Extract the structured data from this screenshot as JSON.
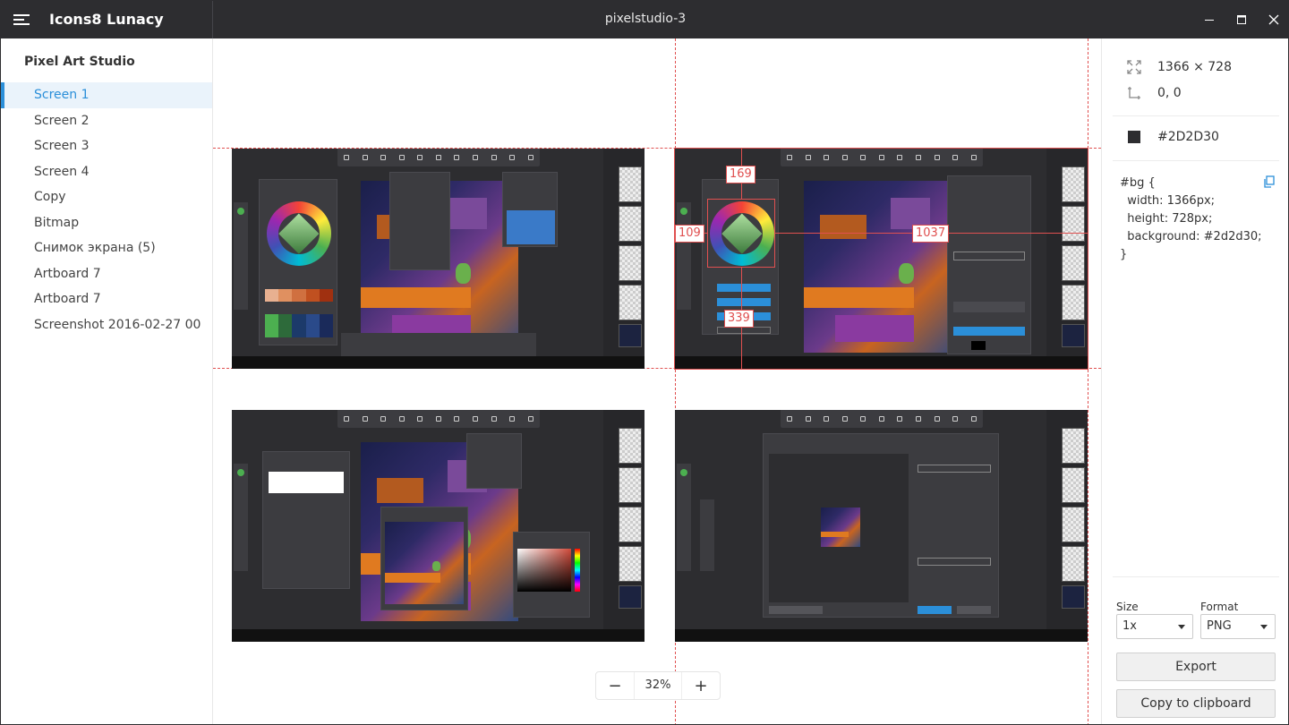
{
  "titlebar": {
    "app_name": "Icons8 Lunacy",
    "document_title": "pixelstudio-3",
    "menu_icon": "hamburger-icon",
    "controls": [
      "minimize-icon",
      "maximize-icon",
      "close-icon"
    ]
  },
  "sidebar": {
    "project_name": "Pixel Art Studio",
    "active_index": 0,
    "items": [
      {
        "label": "Screen 1"
      },
      {
        "label": "Screen 2"
      },
      {
        "label": "Screen 3"
      },
      {
        "label": "Screen 4"
      },
      {
        "label": "Copy"
      },
      {
        "label": "Bitmap"
      },
      {
        "label": "Снимок экрана (5)"
      },
      {
        "label": "Artboard 7"
      },
      {
        "label": "Artboard 7"
      },
      {
        "label": "Screenshot 2016-02-27 00"
      }
    ]
  },
  "canvas": {
    "measurements": {
      "top": "169",
      "left": "109",
      "right": "1037",
      "bottom": "339"
    },
    "accent_color": "#E05050"
  },
  "zoom": {
    "minus": "−",
    "value": "32%",
    "plus": "+"
  },
  "inspector": {
    "size": "1366 × 728",
    "position": "0, 0",
    "fill": "#2D2D30",
    "css": "#bg {\n  width: 1366px;\n  height: 728px;\n  background: #2d2d30;\n}",
    "export": {
      "size_label": "Size",
      "size_value": "1x",
      "format_label": "Format",
      "format_value": "PNG",
      "export_button": "Export",
      "copy_button": "Copy to clipboard"
    }
  },
  "colors": {
    "titlebar": "#2D2D30",
    "accent": "#2B8FD9",
    "guide": "#E05050"
  }
}
